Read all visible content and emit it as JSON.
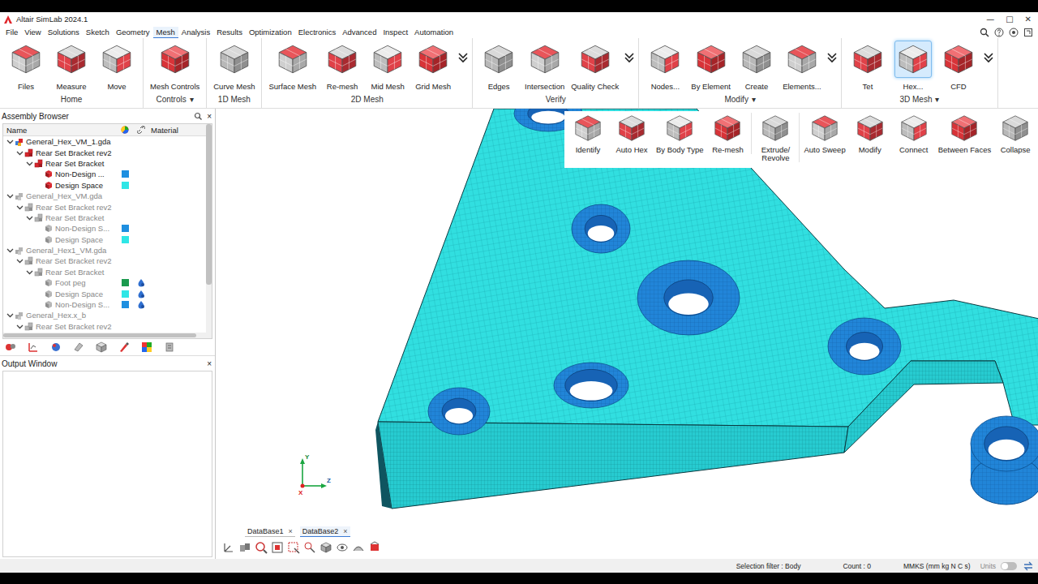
{
  "window": {
    "title": "Altair SimLab 2024.1",
    "controls": [
      "—",
      "□",
      "✕"
    ]
  },
  "menu": [
    {
      "label": "File",
      "selected": false
    },
    {
      "label": "View",
      "selected": false
    },
    {
      "label": "Solutions",
      "selected": false
    },
    {
      "label": "Sketch",
      "selected": false
    },
    {
      "label": "Geometry",
      "selected": false
    },
    {
      "label": "Mesh",
      "selected": true
    },
    {
      "label": "Analysis",
      "selected": false
    },
    {
      "label": "Results",
      "selected": false
    },
    {
      "label": "Optimization",
      "selected": false
    },
    {
      "label": "Electronics",
      "selected": false
    },
    {
      "label": "Advanced",
      "selected": false
    },
    {
      "label": "Inspect",
      "selected": false
    },
    {
      "label": "Automation",
      "selected": false
    }
  ],
  "ribbon": [
    {
      "label": "Home",
      "more": false,
      "items": [
        {
          "label": "Files",
          "selected": false
        },
        {
          "label": "Measure",
          "selected": false
        },
        {
          "label": "Move",
          "selected": false
        }
      ]
    },
    {
      "label": "Controls",
      "arrow": "▾",
      "more": false,
      "items": [
        {
          "label": "Mesh Controls",
          "selected": false
        }
      ]
    },
    {
      "label": "1D Mesh",
      "more": false,
      "items": [
        {
          "label": "Curve Mesh",
          "selected": false
        }
      ]
    },
    {
      "label": "2D Mesh",
      "more": true,
      "items": [
        {
          "label": "Surface Mesh",
          "selected": false
        },
        {
          "label": "Re-mesh",
          "selected": false
        },
        {
          "label": "Mid Mesh",
          "selected": false
        },
        {
          "label": "Grid Mesh",
          "selected": false
        }
      ]
    },
    {
      "label": "Verify",
      "more": true,
      "items": [
        {
          "label": "Edges",
          "selected": false
        },
        {
          "label": "Intersection",
          "selected": false
        },
        {
          "label": "Quality Check",
          "selected": false
        }
      ]
    },
    {
      "label": "Modify",
      "arrow": "▾",
      "more": true,
      "items": [
        {
          "label": "Nodes...",
          "selected": false
        },
        {
          "label": "By Element",
          "selected": false
        },
        {
          "label": "Create",
          "selected": false
        },
        {
          "label": "Elements...",
          "selected": false
        }
      ]
    },
    {
      "label": "3D Mesh",
      "arrow": "▾",
      "more": true,
      "items": [
        {
          "label": "Tet",
          "selected": false
        },
        {
          "label": "Hex...",
          "selected": true
        },
        {
          "label": "CFD",
          "selected": false
        }
      ]
    }
  ],
  "hex_panel": [
    [
      {
        "label": "Identify"
      },
      {
        "label": "Auto Hex"
      },
      {
        "label": "By Body Type"
      },
      {
        "label": "Re-mesh"
      }
    ],
    [
      {
        "label": "Extrude/\nRevolve"
      }
    ],
    [
      {
        "label": "Auto Sweep"
      },
      {
        "label": "Modify"
      },
      {
        "label": "Connect"
      },
      {
        "label": "Between Faces"
      },
      {
        "label": "Collapse"
      }
    ]
  ],
  "assembly_browser": {
    "title": "Assembly Browser",
    "close": "×",
    "columns": {
      "name": "Name",
      "material": "Material"
    },
    "vscroll": {
      "level": 0.75
    },
    "hscroll": {
      "level": 0.95
    },
    "rows": [
      {
        "label": "General_Hex_VM_1.gda",
        "depth": 0,
        "kind": "file",
        "active": true,
        "expanded": true
      },
      {
        "label": "Rear Set Bracket rev2",
        "depth": 1,
        "kind": "assembly",
        "active": true,
        "expanded": true
      },
      {
        "label": "Rear Set Bracket",
        "depth": 2,
        "kind": "assembly",
        "active": true,
        "expanded": true
      },
      {
        "label": "Non-Design ...",
        "depth": 3,
        "kind": "body",
        "active": true,
        "color": "#1e8fe0",
        "material": false
      },
      {
        "label": "Design Space",
        "depth": 3,
        "kind": "body",
        "active": true,
        "color": "#2fe6e6",
        "material": false
      },
      {
        "label": "General_Hex_VM.gda",
        "depth": 0,
        "kind": "file",
        "active": false,
        "expanded": true
      },
      {
        "label": "Rear Set Bracket rev2",
        "depth": 1,
        "kind": "assembly",
        "active": false,
        "expanded": true
      },
      {
        "label": "Rear Set Bracket",
        "depth": 2,
        "kind": "assembly",
        "active": false,
        "expanded": true
      },
      {
        "label": "Non-Design S...",
        "depth": 3,
        "kind": "body",
        "active": false,
        "color": "#1e8fe0",
        "material": false
      },
      {
        "label": "Design Space",
        "depth": 3,
        "kind": "body",
        "active": false,
        "color": "#2fe6e6",
        "material": false
      },
      {
        "label": "General_Hex1_VM.gda",
        "depth": 0,
        "kind": "file",
        "active": false,
        "expanded": true
      },
      {
        "label": "Rear Set Bracket rev2",
        "depth": 1,
        "kind": "assembly",
        "active": false,
        "expanded": true
      },
      {
        "label": "Rear Set Bracket",
        "depth": 2,
        "kind": "assembly",
        "active": false,
        "expanded": true
      },
      {
        "label": "Foot peg",
        "depth": 3,
        "kind": "body",
        "active": false,
        "color": "#1a9a4e",
        "material": true
      },
      {
        "label": "Design Space",
        "depth": 3,
        "kind": "body",
        "active": false,
        "color": "#2fe6e6",
        "material": true
      },
      {
        "label": "Non-Design S...",
        "depth": 3,
        "kind": "body",
        "active": false,
        "color": "#1e8fe0",
        "material": true
      },
      {
        "label": "General_Hex.x_b",
        "depth": 0,
        "kind": "file",
        "active": false,
        "expanded": true
      },
      {
        "label": "Rear Set Bracket rev2",
        "depth": 1,
        "kind": "assembly",
        "active": false,
        "expanded": true
      }
    ]
  },
  "output_window": {
    "title": "Output Window",
    "close": "×"
  },
  "database_tabs": [
    {
      "label": "DataBase1",
      "close": "×",
      "selected": false
    },
    {
      "label": "DataBase2",
      "close": "×",
      "selected": true
    }
  ],
  "triad": {
    "y": "Y",
    "z": "Z",
    "x": "X"
  },
  "status_bar": {
    "selection_filter": "Selection filter : Body",
    "count": "Count : 0",
    "units": "MMKS (mm kg N C s)",
    "units_label": "Units",
    "units_toggle_on": false
  }
}
